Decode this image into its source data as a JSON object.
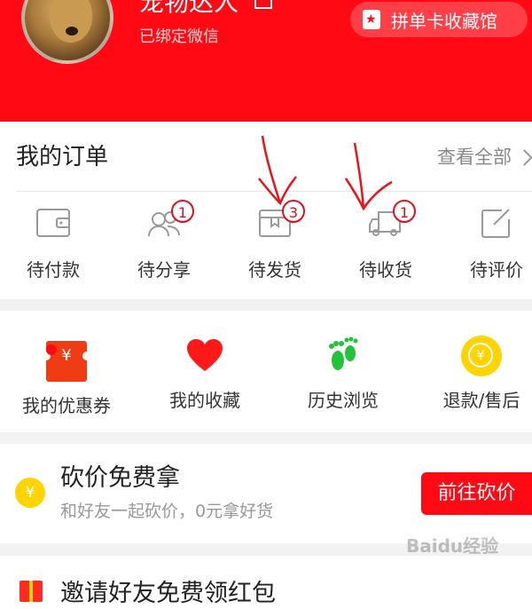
{
  "profile": {
    "username": "宠物达人",
    "bind_status": "已绑定微信",
    "album_button": "拼单卡收藏馆"
  },
  "orders": {
    "title": "我的订单",
    "view_all": "查看全部",
    "items": [
      {
        "label": "待付款",
        "icon": "wallet-icon",
        "badge": ""
      },
      {
        "label": "待分享",
        "icon": "share-group-icon",
        "badge": "1"
      },
      {
        "label": "待发货",
        "icon": "package-box-icon",
        "badge": "3"
      },
      {
        "label": "待收货",
        "icon": "delivery-truck-icon",
        "badge": "1"
      },
      {
        "label": "待评价",
        "icon": "edit-review-icon",
        "badge": ""
      }
    ]
  },
  "tools": {
    "coupon_symbol": "¥",
    "refund_symbol": "¥",
    "items": [
      {
        "label": "我的优惠券",
        "icon": "coupon-icon"
      },
      {
        "label": "我的收藏",
        "icon": "heart-icon"
      },
      {
        "label": "历史浏览",
        "icon": "footprints-icon"
      },
      {
        "label": "退款/售后",
        "icon": "refund-coin-icon"
      }
    ]
  },
  "bargain": {
    "coin_symbol": "¥",
    "title": "砍价免费拿",
    "subtitle": "和好友一起砍价，0元拿好货",
    "button": "前往砍价"
  },
  "invite": {
    "title": "邀请好友免费领红包"
  },
  "watermark": "Baidu经验",
  "colors": {
    "brand_red": "#ff0a14",
    "badge_red": "#e0101a",
    "coin_yellow": "#ffd400",
    "footprint_green": "#22c33a"
  }
}
